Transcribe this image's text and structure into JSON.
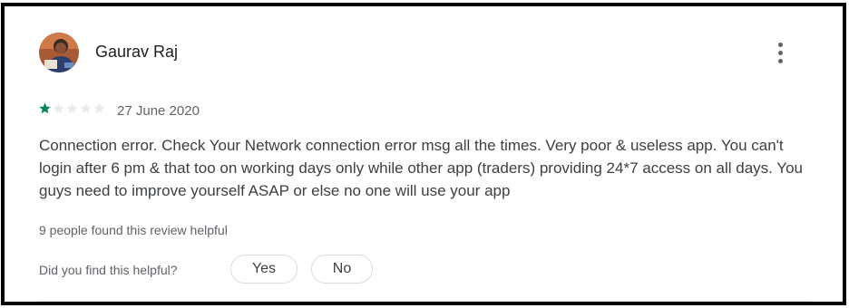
{
  "review": {
    "author": "Gaurav Raj",
    "rating": 1,
    "max_rating": 5,
    "date": "27 June 2020",
    "text": "Connection error. Check Your Network connection error msg all the times. Very poor & useless app. You can't login after 6 pm & that too on working days only while other app (traders) providing 24*7 access on all days. You guys need to improve yourself ASAP or else no one will use your app",
    "helpful_count_text": "9 people found this review helpful",
    "helpful_question": "Did you find this helpful?",
    "yes_label": "Yes",
    "no_label": "No"
  },
  "icons": {
    "avatar": "user-avatar-photo",
    "more": "more-vert-icon",
    "star": "star-icon"
  },
  "colors": {
    "star_filled": "#01875f",
    "star_empty": "#e8eaed",
    "text_primary": "#202124",
    "text_secondary": "#5f6368"
  }
}
